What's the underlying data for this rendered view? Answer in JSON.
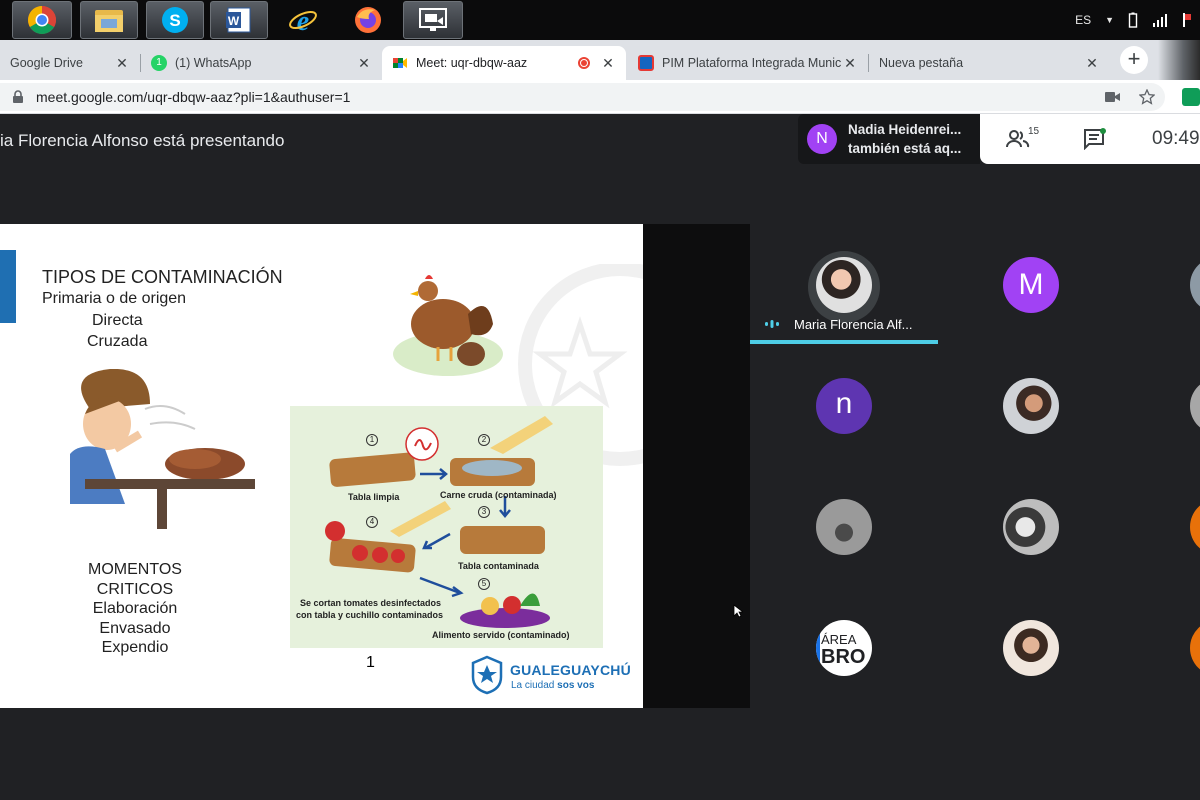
{
  "taskbar": {
    "apps": [
      "chrome-icon",
      "file-explorer-icon",
      "skype-icon",
      "word-icon",
      "internet-explorer-icon",
      "firefox-icon",
      "meet-present-icon"
    ]
  },
  "tray": {
    "lang": "ES"
  },
  "tabs": [
    {
      "title": "Google Drive",
      "close": "✕"
    },
    {
      "title": "(1) WhatsApp",
      "close": "✕"
    },
    {
      "title": "Meet: uqr-dbqw-aaz",
      "close": "✕"
    },
    {
      "title": "PIM Plataforma Integrada Munic",
      "close": "✕"
    },
    {
      "title": "Nueva pestaña",
      "close": "✕"
    }
  ],
  "newtab": "+",
  "address": {
    "url": "meet.google.com/uqr-dbqw-aaz?pli=1&authuser=1"
  },
  "meet": {
    "presenting": "ia Florencia Alfonso está presentando",
    "notif_name": "Nadia Heidenrei...",
    "notif_text": "también está aq...",
    "notif_avatar": "N",
    "people_count": "15",
    "time": "09:49"
  },
  "slide": {
    "title": "TIPOS DE CONTAMINACIÓN",
    "line1": "Primaria o de origen",
    "line2": "Directa",
    "line3": "Cruzada",
    "momentos": [
      "MOMENTOS",
      "CRITICOS",
      "Elaboración",
      "Envasado",
      "Expendio"
    ],
    "steps": {
      "s1": "1",
      "s2": "2",
      "s3": "3",
      "s4": "4",
      "s5": "5",
      "tabla_limpia": "Tabla limpia",
      "carne": "Carne cruda (contaminada)",
      "tabla_cont": "Tabla contaminada",
      "tomates1": "Se cortan tomates desinfectados",
      "tomates2": "con tabla y cuchillo contaminados",
      "servido": "Alimento servido (contaminado)"
    },
    "logo_name": "GUALEGUAYCHÚ",
    "logo_tag1": "La ciudad",
    "logo_tag2": "sos vos"
  },
  "participants": {
    "presenter_name": "Maria Florencia Alf...",
    "m_initial": "M",
    "n_initial": "n",
    "area1": "ÁREA",
    "area2": "BRO"
  },
  "colors": {
    "accent": "#1a73e8",
    "speaking": "#4ecde6",
    "m_avatar": "#a142f4",
    "n_avatar": "#5e35b1",
    "orange": "#e8710a"
  }
}
